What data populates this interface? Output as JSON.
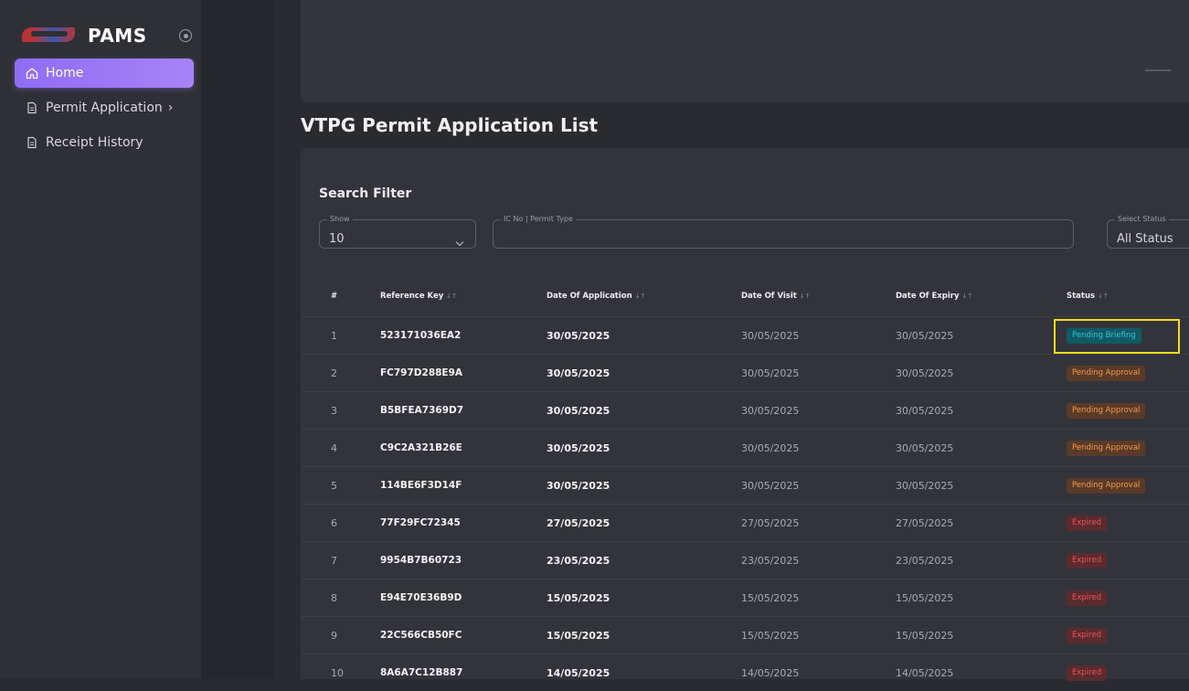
{
  "app": {
    "name": "PAMS"
  },
  "sidebar": {
    "items": [
      {
        "label": "Home",
        "icon": "home-icon",
        "active": true
      },
      {
        "label": "Permit Application",
        "icon": "document-icon",
        "chevron": "›"
      },
      {
        "label": "Receipt History",
        "icon": "document-icon"
      }
    ]
  },
  "page": {
    "title": "VTPG Permit Application List"
  },
  "filter": {
    "title": "Search Filter",
    "show": {
      "legend": "Show",
      "value": "10"
    },
    "search": {
      "legend": "IC No | Permit Type",
      "value": ""
    },
    "status": {
      "legend": "Select Status",
      "value": "All Status"
    }
  },
  "table": {
    "headers": [
      "#",
      "Reference Key",
      "Date Of Application",
      "Date Of Visit",
      "Date Of Expiry",
      "Status"
    ],
    "sort_glyph": "↓↑",
    "rows": [
      {
        "no": "1",
        "ref": "523171036EA2",
        "applied": "30/05/2025",
        "visit": "30/05/2025",
        "expiry": "30/05/2025",
        "status": "Pending Briefing",
        "kind": "briefing",
        "highlighted": true
      },
      {
        "no": "2",
        "ref": "FC797D288E9A",
        "applied": "30/05/2025",
        "visit": "30/05/2025",
        "expiry": "30/05/2025",
        "status": "Pending Approval",
        "kind": "approval"
      },
      {
        "no": "3",
        "ref": "B5BFEA7369D7",
        "applied": "30/05/2025",
        "visit": "30/05/2025",
        "expiry": "30/05/2025",
        "status": "Pending Approval",
        "kind": "approval"
      },
      {
        "no": "4",
        "ref": "C9C2A321B26E",
        "applied": "30/05/2025",
        "visit": "30/05/2025",
        "expiry": "30/05/2025",
        "status": "Pending Approval",
        "kind": "approval"
      },
      {
        "no": "5",
        "ref": "114BE6F3D14F",
        "applied": "30/05/2025",
        "visit": "30/05/2025",
        "expiry": "30/05/2025",
        "status": "Pending Approval",
        "kind": "approval"
      },
      {
        "no": "6",
        "ref": "77F29FC72345",
        "applied": "27/05/2025",
        "visit": "27/05/2025",
        "expiry": "27/05/2025",
        "status": "Expired",
        "kind": "expired"
      },
      {
        "no": "7",
        "ref": "9954B7B60723",
        "applied": "23/05/2025",
        "visit": "23/05/2025",
        "expiry": "23/05/2025",
        "status": "Expired",
        "kind": "expired"
      },
      {
        "no": "8",
        "ref": "E94E70E36B9D",
        "applied": "15/05/2025",
        "visit": "15/05/2025",
        "expiry": "15/05/2025",
        "status": "Expired",
        "kind": "expired"
      },
      {
        "no": "9",
        "ref": "22C566CB50FC",
        "applied": "15/05/2025",
        "visit": "15/05/2025",
        "expiry": "15/05/2025",
        "status": "Expired",
        "kind": "expired"
      },
      {
        "no": "10",
        "ref": "8A6A7C12B887",
        "applied": "14/05/2025",
        "visit": "14/05/2025",
        "expiry": "14/05/2025",
        "status": "Expired",
        "kind": "expired"
      }
    ]
  },
  "colors": {
    "accent": "#9a78f5",
    "briefing": "#2cc7d8",
    "approval": "#f29a4c",
    "expired": "#e9545a",
    "highlight": "#f2dd1a"
  }
}
